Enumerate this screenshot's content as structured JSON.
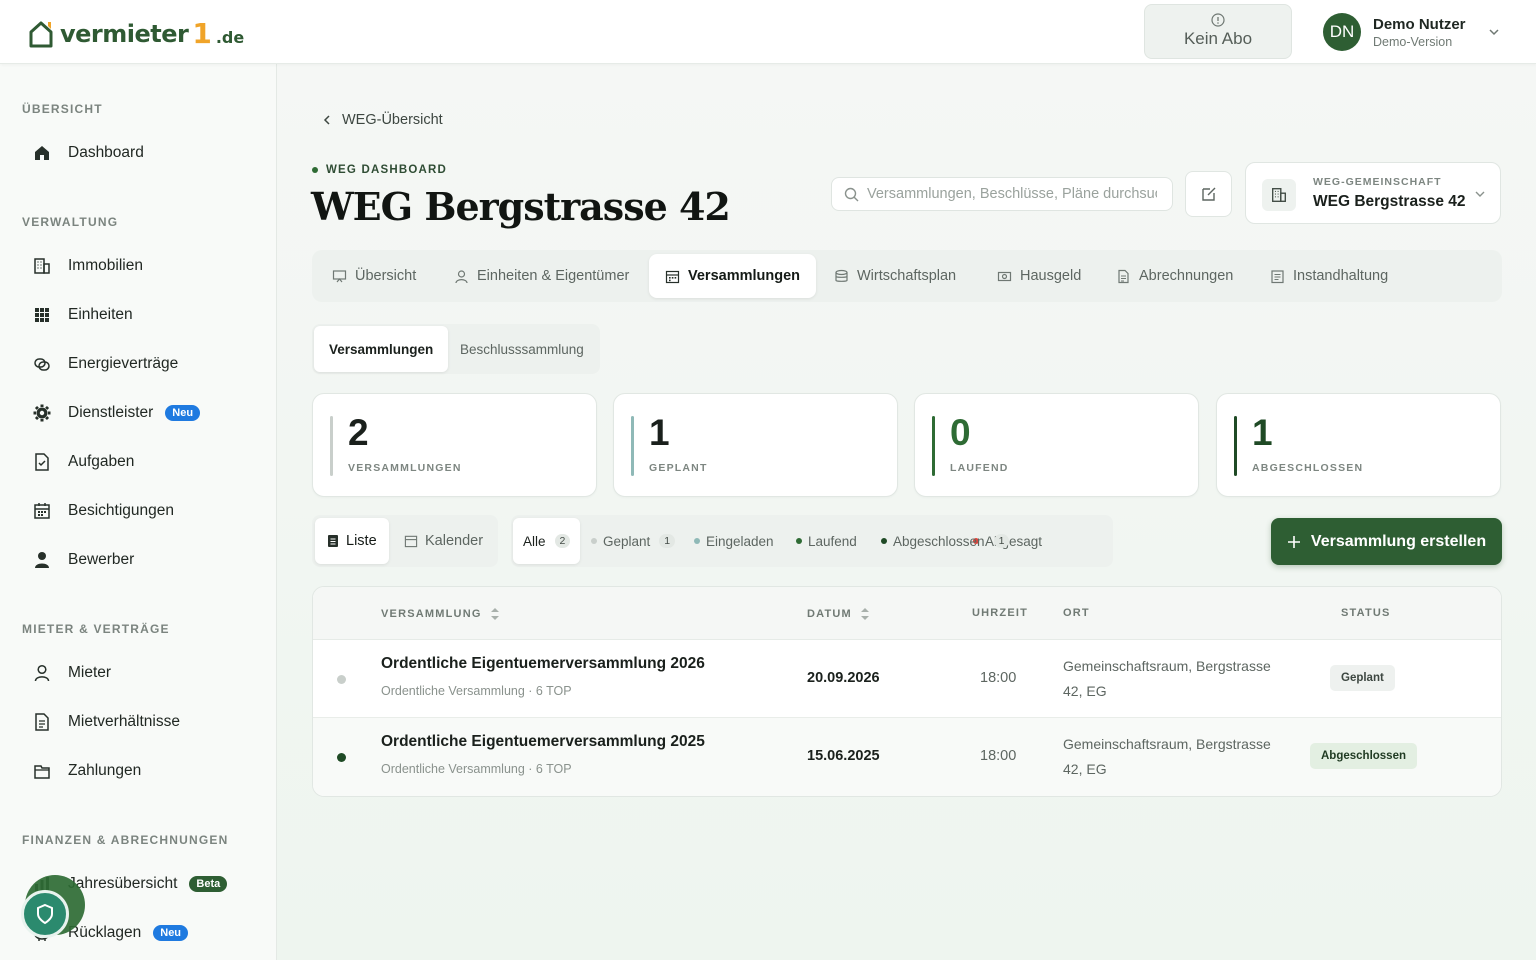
{
  "header": {
    "logo": {
      "text": "vermieter",
      "accent": "1",
      "tld": ".de"
    },
    "abo_label": "Kein Abo",
    "user": {
      "initials": "DN",
      "name": "Demo Nutzer",
      "subtitle": "Demo-Version"
    }
  },
  "sidebar": {
    "sections": [
      {
        "title": "ÜBERSICHT",
        "items": [
          {
            "label": "Dashboard",
            "icon": "home-icon"
          }
        ]
      },
      {
        "title": "VERWALTUNG",
        "items": [
          {
            "label": "Immobilien",
            "icon": "building-icon"
          },
          {
            "label": "Einheiten",
            "icon": "grid-icon"
          },
          {
            "label": "Energieverträge",
            "icon": "energy-icon"
          },
          {
            "label": "Dienstleister",
            "icon": "gear-icon",
            "badge": "Neu"
          },
          {
            "label": "Aufgaben",
            "icon": "task-icon"
          },
          {
            "label": "Besichtigungen",
            "icon": "calendar-icon"
          },
          {
            "label": "Bewerber",
            "icon": "person-icon"
          }
        ]
      },
      {
        "title": "MIETER & VERTRÄGE",
        "items": [
          {
            "label": "Mieter",
            "icon": "user-icon"
          },
          {
            "label": "Mietverhältnisse",
            "icon": "document-icon"
          },
          {
            "label": "Zahlungen",
            "icon": "wallet-icon"
          }
        ]
      },
      {
        "title": "FINANZEN & ABRECHNUNGEN",
        "items": [
          {
            "label": "Jahresübersicht",
            "icon": "chart-icon",
            "badge": "Beta"
          },
          {
            "label": "Rücklagen",
            "icon": "piggy-icon",
            "badge": "Neu"
          }
        ]
      }
    ]
  },
  "main": {
    "back_label": "WEG-Übersicht",
    "eyebrow": "WEG DASHBOARD",
    "title": "WEG Bergstrasse 42",
    "search_placeholder": "Versammlungen, Beschlüsse, Pläne durchsuchen",
    "weg_selector": {
      "label": "WEG-GEMEINSCHAFT",
      "value": "WEG Bergstrasse 42"
    },
    "tabs": [
      {
        "label": "Übersicht"
      },
      {
        "label": "Einheiten & Eigentümer"
      },
      {
        "label": "Versammlungen",
        "active": true
      },
      {
        "label": "Wirtschaftsplan"
      },
      {
        "label": "Hausgeld"
      },
      {
        "label": "Abrechnungen"
      },
      {
        "label": "Instandhaltung"
      }
    ],
    "subtabs": [
      {
        "label": "Versammlungen",
        "active": true
      },
      {
        "label": "Beschlusssammlung"
      }
    ],
    "stats": [
      {
        "value": "2",
        "label": "VERSAMMLUNGEN",
        "color": "#c9cfcb"
      },
      {
        "value": "1",
        "label": "GEPLANT",
        "color": "#8fb9b7"
      },
      {
        "value": "0",
        "label": "LAUFEND",
        "color": "#2e6b34"
      },
      {
        "value": "1",
        "label": "ABGESCHLOSSEN",
        "color": "#1f4a25"
      }
    ],
    "view_toggle": [
      {
        "label": "Liste",
        "active": true
      },
      {
        "label": "Kalender"
      }
    ],
    "filters": [
      {
        "label": "Alle",
        "count": "2",
        "active": true
      },
      {
        "label": "Geplant",
        "count": "1",
        "color": "#c9cfcb"
      },
      {
        "label": "Eingeladen",
        "color": "#8fb9b7"
      },
      {
        "label": "Laufend",
        "color": "#2e6b34"
      },
      {
        "label": "Abgeschlossen",
        "count": "1",
        "color": "#1f4a25"
      },
      {
        "label": "Abgesagt",
        "color": "#e0453c"
      }
    ],
    "create_label": "Versammlung erstellen",
    "table": {
      "headers": {
        "name": "VERSAMMLUNG",
        "date": "DATUM",
        "time": "UHRZEIT",
        "location": "ORT",
        "status": "STATUS"
      },
      "rows": [
        {
          "title": "Ordentliche Eigentuemerversammlung 2026",
          "subtitle": "Ordentliche Versammlung · 6 TOP",
          "date": "20.09.2026",
          "time": "18:00",
          "location": "Gemeinschaftsraum, Bergstrasse 42, EG",
          "status": "Geplant",
          "dot": "#c9cfcb"
        },
        {
          "title": "Ordentliche Eigentuemerversammlung 2025",
          "subtitle": "Ordentliche Versammlung · 6 TOP",
          "date": "15.06.2025",
          "time": "18:00",
          "location": "Gemeinschaftsraum, Bergstrasse 42, EG",
          "status": "Abgeschlossen",
          "dot": "#1f4a25"
        }
      ]
    }
  },
  "colors": {
    "brand": "#2e5e33",
    "accent": "#f0a429",
    "badge_blue": "#1f7ae0"
  }
}
